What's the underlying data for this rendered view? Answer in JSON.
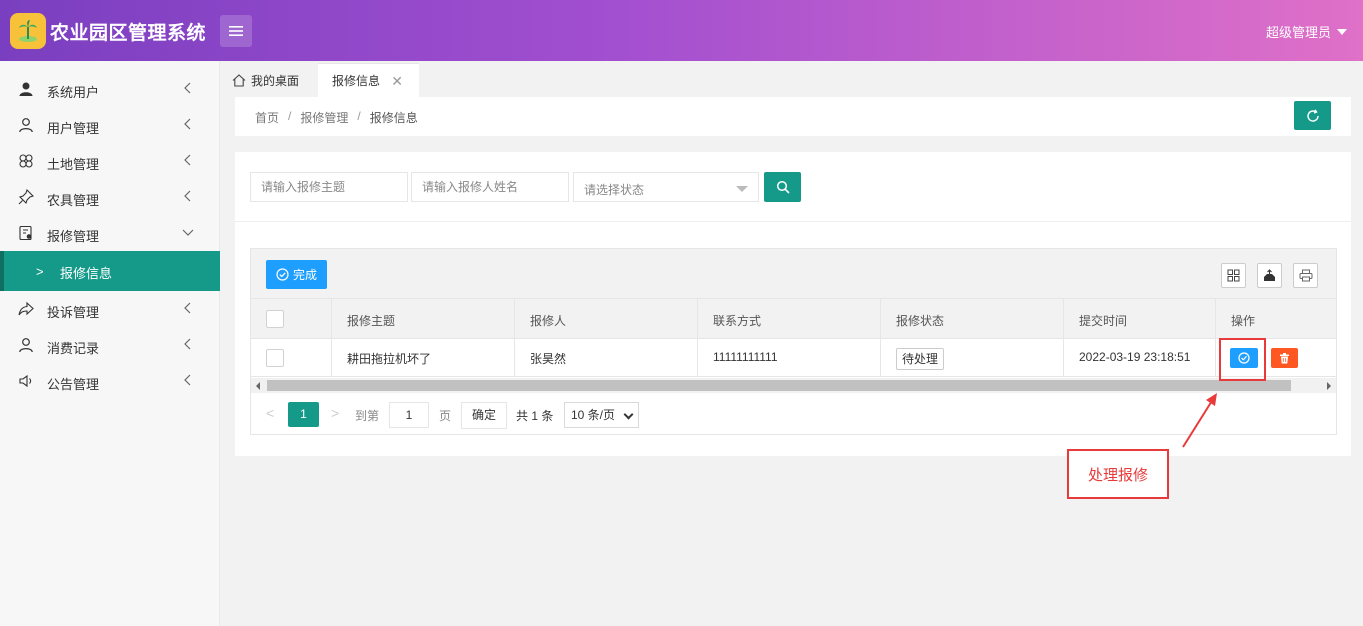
{
  "header": {
    "brand": "农业园区管理系统",
    "user_label": "超级管理员"
  },
  "sidebar": {
    "items": [
      {
        "label": "系统用户",
        "icon": "user-solid-icon"
      },
      {
        "label": "用户管理",
        "icon": "user-outline-icon"
      },
      {
        "label": "土地管理",
        "icon": "flower-icon"
      },
      {
        "label": "农具管理",
        "icon": "pin-icon"
      },
      {
        "label": "报修管理",
        "icon": "repair-doc-icon"
      },
      {
        "label": "投诉管理",
        "icon": "share-icon"
      },
      {
        "label": "消费记录",
        "icon": "user-outline-icon"
      },
      {
        "label": "公告管理",
        "icon": "speaker-icon"
      }
    ],
    "active_sub": "报修信息"
  },
  "tabs": [
    {
      "label": "我的桌面"
    },
    {
      "label": "报修信息"
    }
  ],
  "breadcrumb": [
    "首页",
    "报修管理",
    "报修信息"
  ],
  "search": {
    "subject_placeholder": "请输入报修主题",
    "name_placeholder": "请输入报修人姓名",
    "status_placeholder": "请选择状态"
  },
  "toolbar": {
    "done_label": "完成"
  },
  "table": {
    "columns": [
      "报修主题",
      "报修人",
      "联系方式",
      "报修状态",
      "提交时间",
      "操作"
    ],
    "rows": [
      {
        "subject": "耕田拖拉机坏了",
        "reporter": "张昊然",
        "phone": "11111111111",
        "status": "待处理",
        "time": "2022-03-19 23:18:51"
      }
    ]
  },
  "pager": {
    "current_page": "1",
    "goto_label": "到第",
    "goto_value": "1",
    "page_label": "页",
    "ok_label": "确定",
    "total_label": "共 1 条",
    "page_size": "10 条/页"
  },
  "annotation": {
    "callout_text": "处理报修",
    "color": "#e83a3a"
  },
  "colors": {
    "primary": "#159a8a",
    "blue": "#1e9fff",
    "danger": "#ff5722"
  }
}
